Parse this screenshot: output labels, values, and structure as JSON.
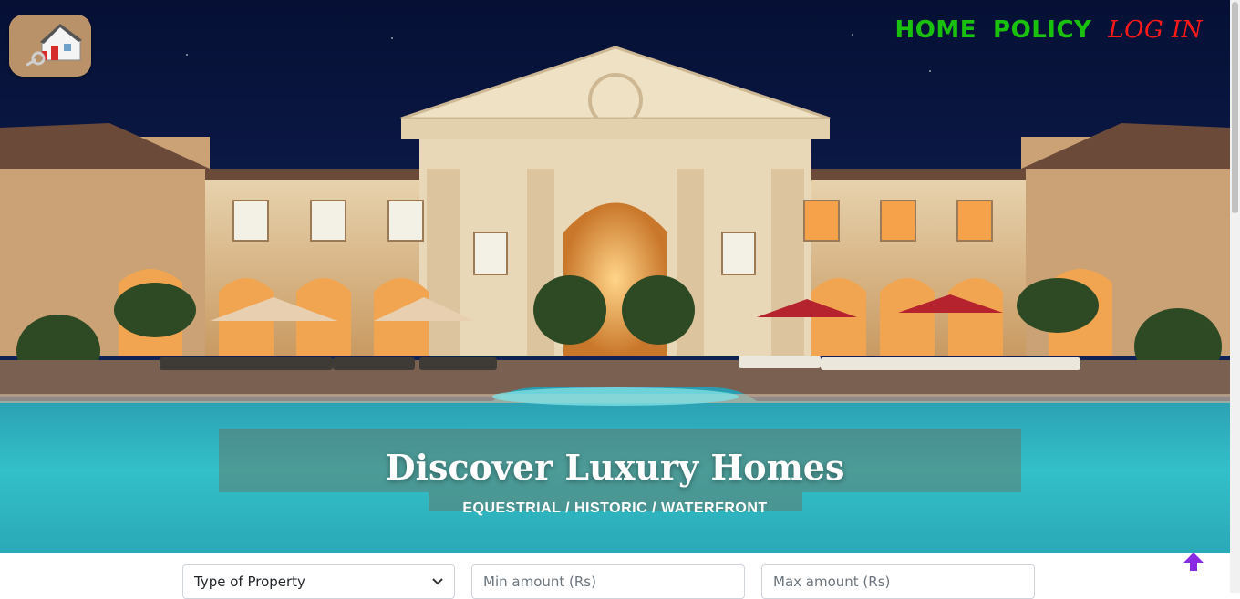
{
  "nav": {
    "home": "HOME",
    "policy": "POLICY",
    "login": "LOG IN"
  },
  "hero": {
    "title": "Discover Luxury Homes",
    "subtitle": "EQUESTRIAL / HISTORIC / WATERFRONT"
  },
  "search": {
    "property_type": "Type of Property",
    "min_amount_placeholder": "Min amount (Rs)",
    "max_amount_placeholder": "Max amount (Rs)"
  },
  "icons": {
    "logo": "house-key-icon",
    "scroll_top": "arrow-up-icon",
    "select_caret": "chevron-down-icon"
  },
  "colors": {
    "nav_green": "#19c00d",
    "login_red": "#ff1a1a",
    "scroll_top_purple": "#8a2be2"
  }
}
